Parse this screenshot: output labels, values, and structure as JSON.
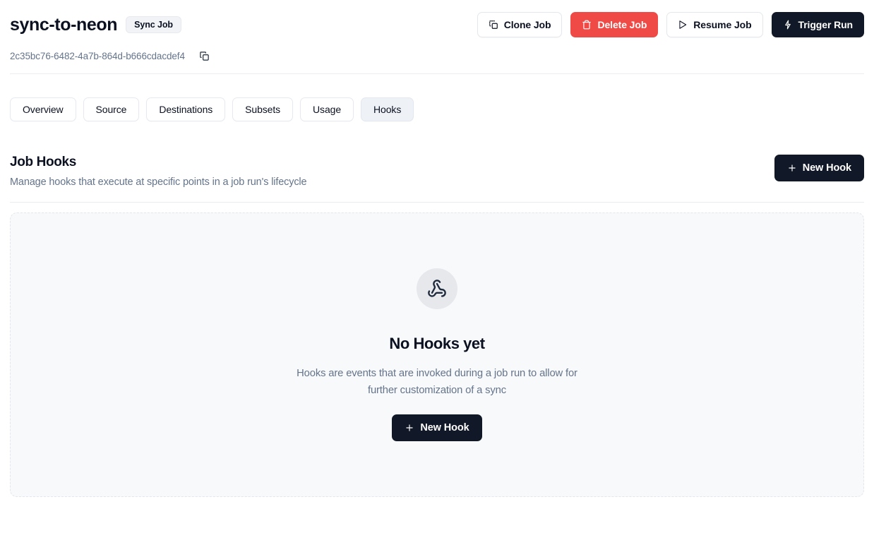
{
  "header": {
    "job_title": "sync-to-neon",
    "badge_label": "Sync Job",
    "actions": [
      {
        "id": "clone-job",
        "label": "Clone Job",
        "icon": "copy-dashed-icon",
        "style": "outline"
      },
      {
        "id": "delete-job",
        "label": "Delete Job",
        "icon": "trash-icon",
        "style": "danger"
      },
      {
        "id": "resume-job",
        "label": "Resume Job",
        "icon": "play-icon",
        "style": "outline"
      },
      {
        "id": "trigger-run",
        "label": "Trigger Run",
        "icon": "lightning-icon",
        "style": "dark"
      }
    ]
  },
  "identifier": {
    "uuid": "2c35bc76-6482-4a7b-864d-b666cdacdef4",
    "copy_icon": "copy-icon"
  },
  "tabs": [
    {
      "id": "overview",
      "label": "Overview",
      "active": false
    },
    {
      "id": "source",
      "label": "Source",
      "active": false
    },
    {
      "id": "destinations",
      "label": "Destinations",
      "active": false
    },
    {
      "id": "subsets",
      "label": "Subsets",
      "active": false
    },
    {
      "id": "usage",
      "label": "Usage",
      "active": false
    },
    {
      "id": "hooks",
      "label": "Hooks",
      "active": true
    }
  ],
  "section": {
    "title": "Job Hooks",
    "subtitle": "Manage hooks that execute at specific points in a job run's lifecycle",
    "new_hook_label": "New Hook",
    "new_hook_icon": "plus-icon"
  },
  "empty_state": {
    "icon": "webhook-icon",
    "title": "No Hooks yet",
    "description": "Hooks are events that are invoked during a job run to allow for further customization of a sync",
    "action_label": "New Hook",
    "action_icon": "plus-icon"
  },
  "colors": {
    "danger": "#f04a46",
    "dark": "#111827",
    "muted_text": "#64748b",
    "active_tab_bg": "#eef1f6",
    "empty_card_bg": "#f8f9fb"
  }
}
